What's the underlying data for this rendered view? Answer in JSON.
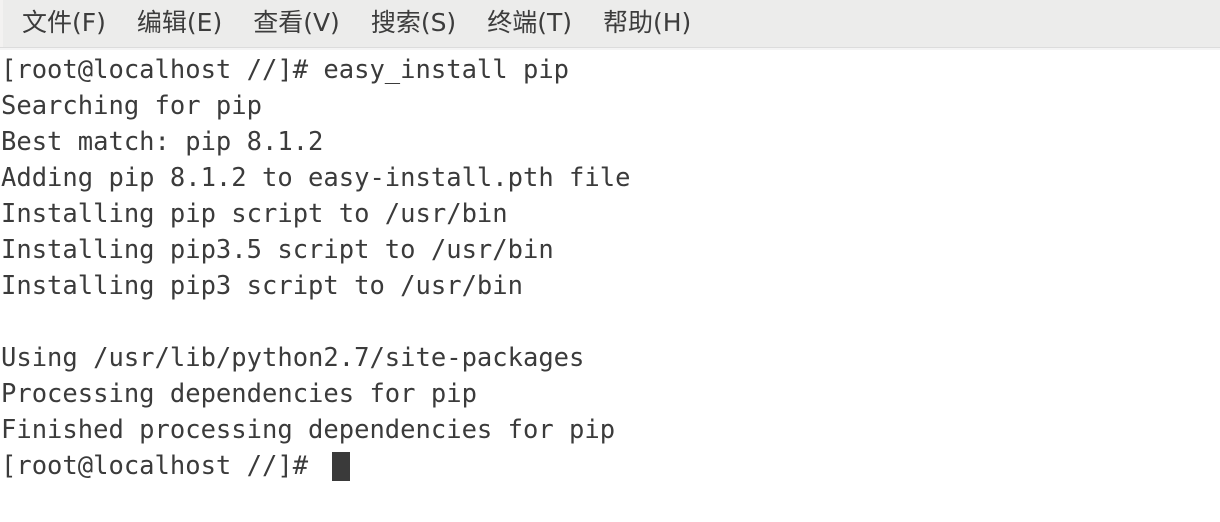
{
  "window": {
    "app": "terminal",
    "background_color": "#ffffff",
    "text_color": "#3b3b3b",
    "menubar_color": "#ececeb"
  },
  "menubar": {
    "items": [
      {
        "label": "文件(F)",
        "name": "menu-file"
      },
      {
        "label": "编辑(E)",
        "name": "menu-edit"
      },
      {
        "label": "查看(V)",
        "name": "menu-view"
      },
      {
        "label": "搜索(S)",
        "name": "menu-search"
      },
      {
        "label": "终端(T)",
        "name": "menu-terminal"
      },
      {
        "label": "帮助(H)",
        "name": "menu-help"
      }
    ]
  },
  "terminal": {
    "lines": [
      "[root@localhost //]# easy_install pip",
      "Searching for pip",
      "Best match: pip 8.1.2",
      "Adding pip 8.1.2 to easy-install.pth file",
      "Installing pip script to /usr/bin",
      "Installing pip3.5 script to /usr/bin",
      "Installing pip3 script to /usr/bin",
      "",
      "Using /usr/lib/python2.7/site-packages",
      "Processing dependencies for pip",
      "Finished processing dependencies for pip"
    ],
    "prompt": "[root@localhost //]# ",
    "cursor": {
      "shape": "block",
      "color": "#3a3a3a"
    }
  }
}
